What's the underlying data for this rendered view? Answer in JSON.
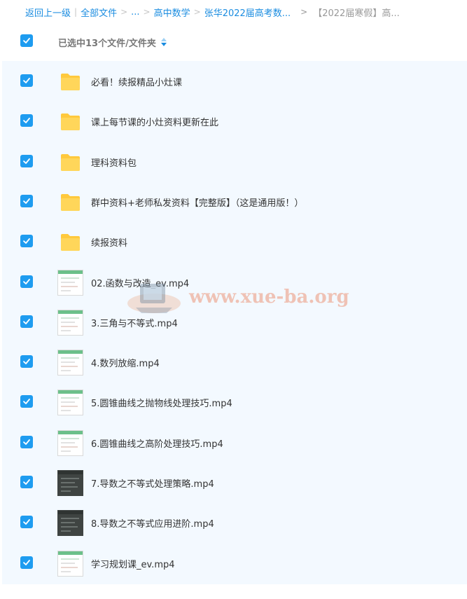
{
  "breadcrumb": {
    "back": "返回上一级",
    "all_files": "全部文件",
    "ellipsis": "...",
    "level1": "高中数学",
    "level2": "张华2022届高考数...",
    "arrow": ">",
    "current": "【2022届寒假】高..."
  },
  "header": {
    "selection_label": "已选中13个文件/文件夹"
  },
  "files": [
    {
      "name": "必看！续报精品小灶课",
      "type": "folder-icon"
    },
    {
      "name": "课上每节课的小灶资料更新在此",
      "type": "folder-icon"
    },
    {
      "name": "理科资料包",
      "type": "folder-icon"
    },
    {
      "name": "群中资料+老师私发资料【完整版】（这是通用版！）",
      "type": "folder-icon"
    },
    {
      "name": "续报资料",
      "type": "folder-icon"
    },
    {
      "name": "02.函数与改造_ev.mp4",
      "type": "video-thumbnail"
    },
    {
      "name": "3.三角与不等式.mp4",
      "type": "video-thumbnail"
    },
    {
      "name": "4.数列放缩.mp4",
      "type": "video-thumbnail"
    },
    {
      "name": "5.圆锥曲线之抛物线处理技巧.mp4",
      "type": "video-thumbnail"
    },
    {
      "name": "6.圆锥曲线之高阶处理技巧.mp4",
      "type": "video-thumbnail"
    },
    {
      "name": "7.导数之不等式处理策略.mp4",
      "type": "video-thumbnail-dark"
    },
    {
      "name": "8.导数之不等式应用进阶.mp4",
      "type": "video-thumbnail-dark"
    },
    {
      "name": "学习规划课_ev.mp4",
      "type": "video-thumbnail"
    }
  ],
  "watermark": "www.xue-ba.org",
  "colors": {
    "link": "#1a8ce0",
    "checkbox": "#1e9cf0",
    "list_bg": "#f3f9ff",
    "folder": "#ffc93d"
  }
}
